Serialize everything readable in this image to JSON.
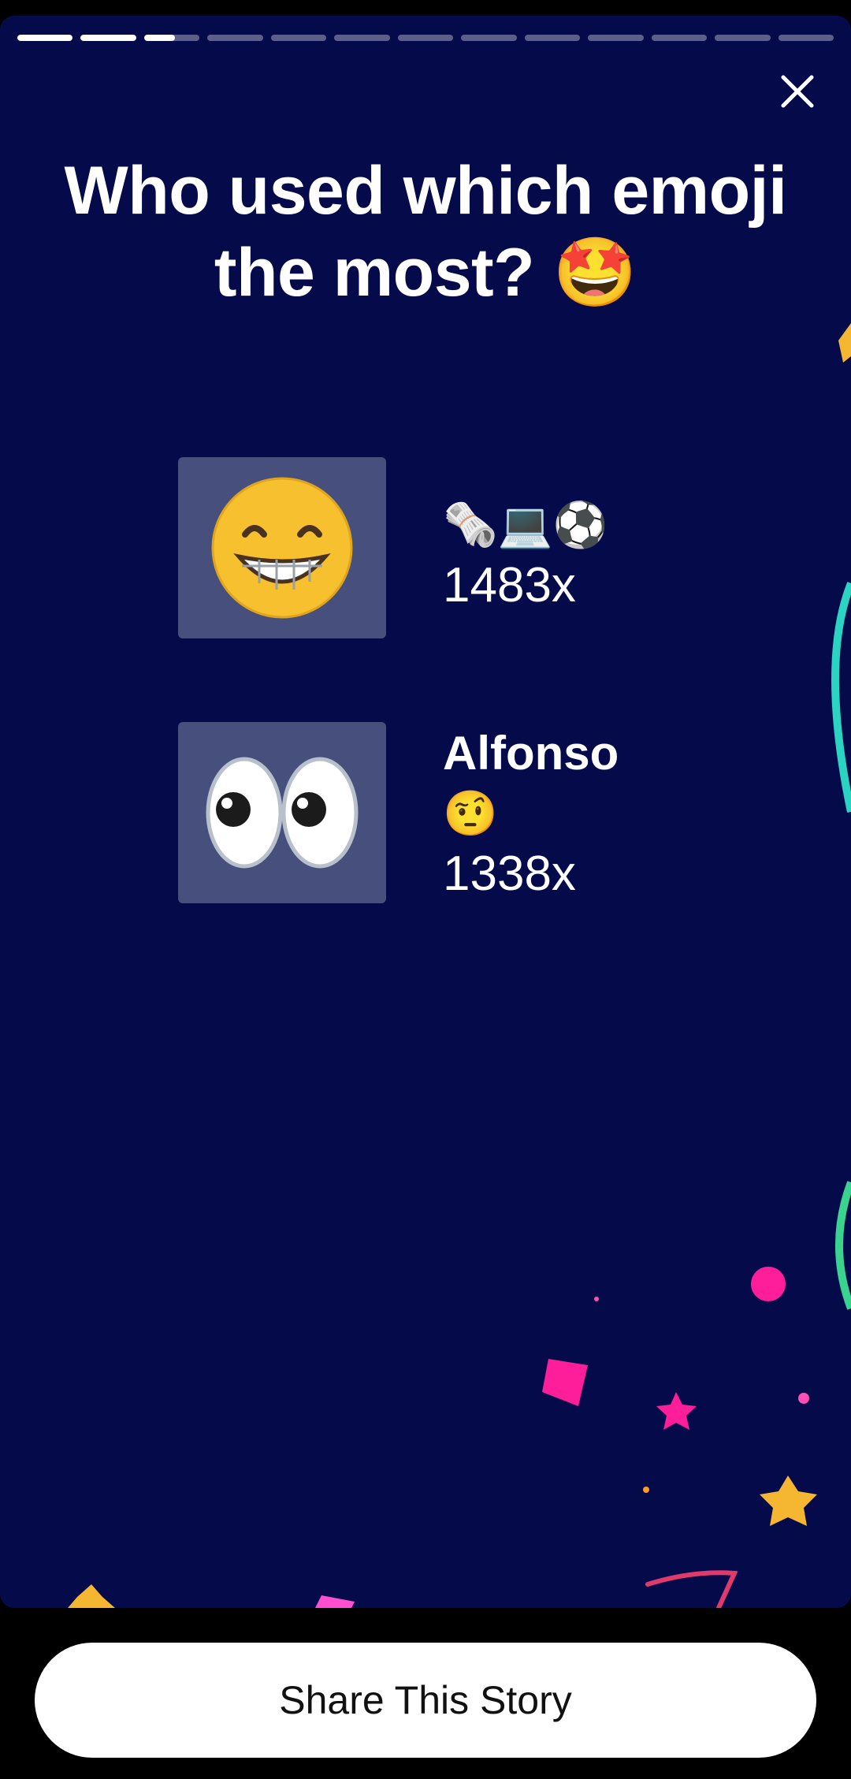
{
  "story": {
    "progress_total": 13,
    "progress_current": 3,
    "close_label": "Close"
  },
  "title": "Who used which emoji the most? 🤩",
  "entries": [
    {
      "emoji": "😁",
      "name": "",
      "users": "🗞️💻⚽",
      "count": "1483x"
    },
    {
      "emoji": "👀",
      "name": "Alfonso",
      "users": "🤨",
      "count": "1338x"
    }
  ],
  "share_button": "Share This Story",
  "colors": {
    "background": "#050b4a",
    "tile": "#47507c",
    "accent_pink": "#ff1e9a",
    "accent_yellow": "#f5b631"
  }
}
